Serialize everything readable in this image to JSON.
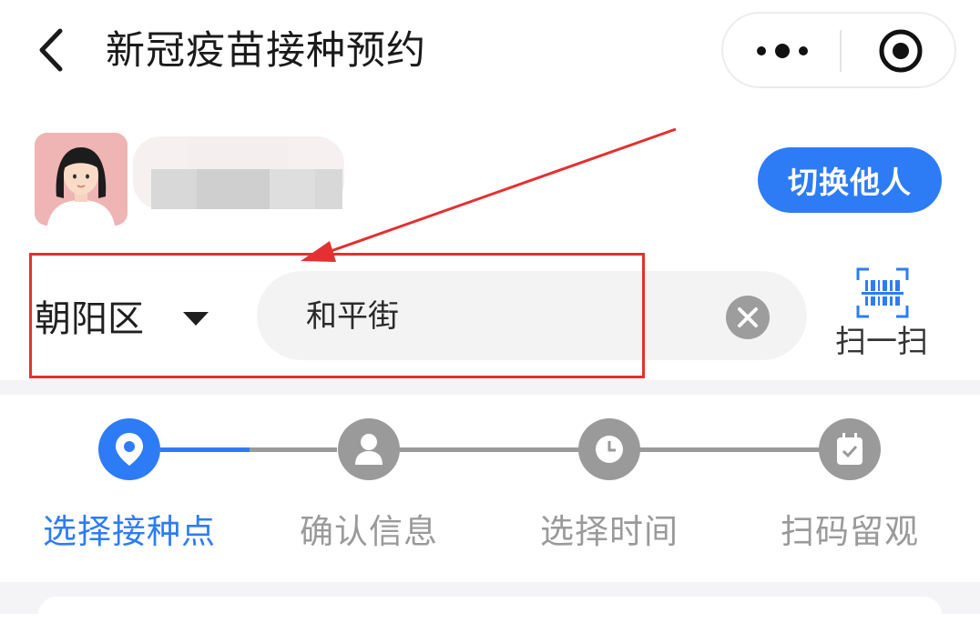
{
  "header": {
    "title": "新冠疫苗接种预约",
    "back_icon": "chevron-left-icon",
    "more_icon": "more-dots-icon",
    "target_icon": "target-icon"
  },
  "user": {
    "avatar_icon": "avatar-female-icon",
    "switch_label": "切换他人"
  },
  "search": {
    "district": "朝阳区",
    "query": "和平街",
    "scan_label": "扫一扫"
  },
  "steps": [
    {
      "label": "选择接种点",
      "icon": "location-pin-icon",
      "active": true
    },
    {
      "label": "确认信息",
      "icon": "person-icon",
      "active": false
    },
    {
      "label": "选择时间",
      "icon": "clock-icon",
      "active": false
    },
    {
      "label": "扫码留观",
      "icon": "calendar-check-icon",
      "active": false
    }
  ],
  "colors": {
    "accent": "#2d7cf5",
    "inactive": "#9a9a9a",
    "annotation": "#e43030",
    "avatar_bg": "#efb4b4"
  }
}
